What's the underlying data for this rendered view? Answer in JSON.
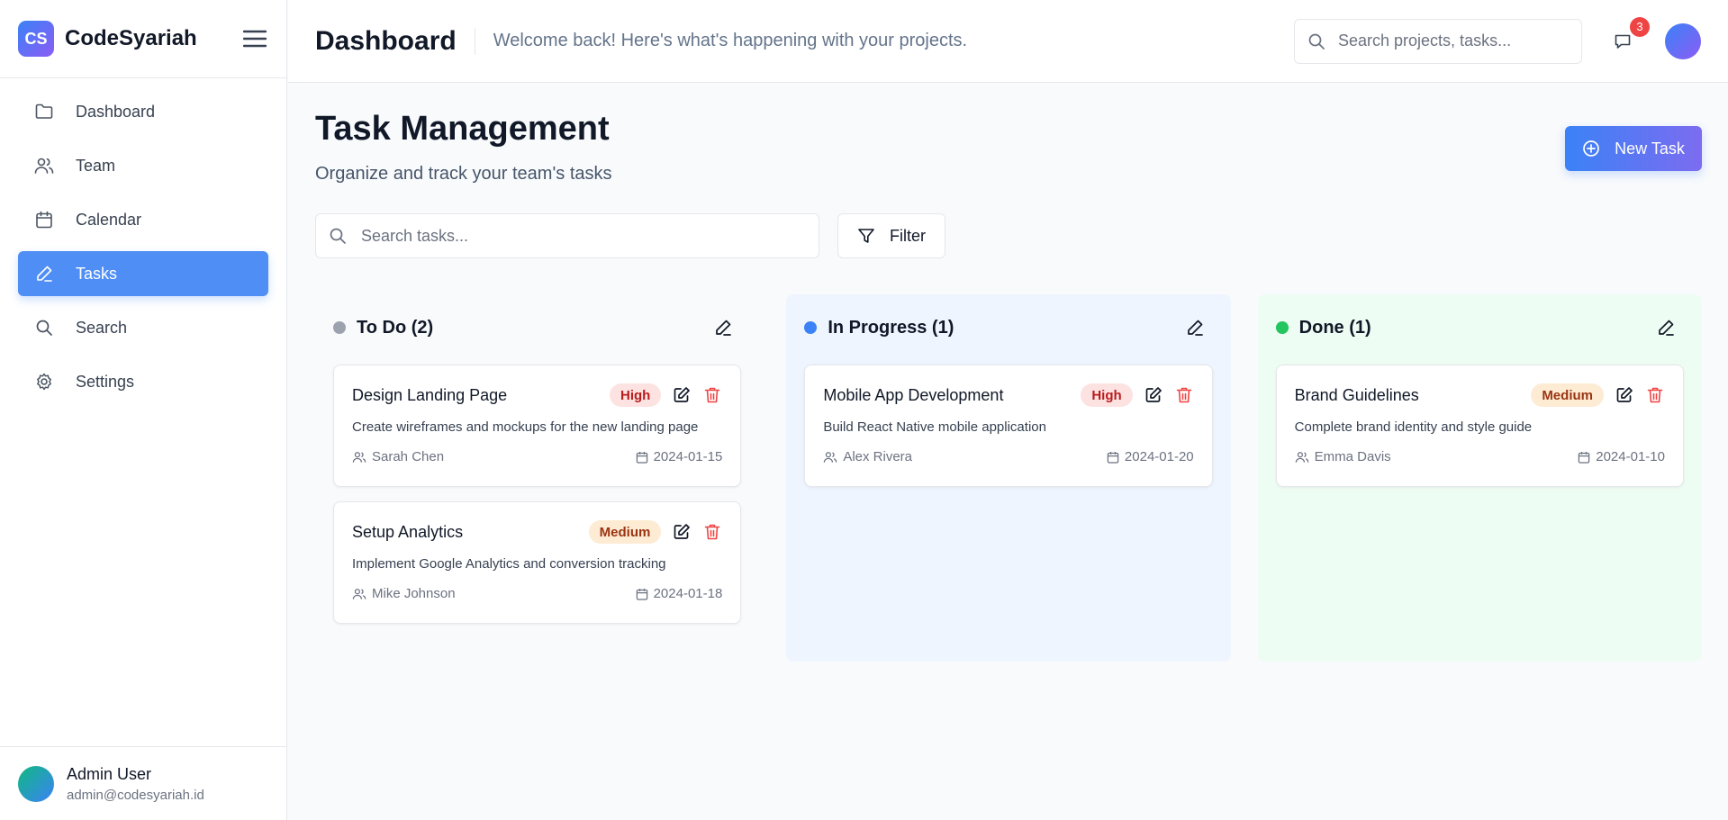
{
  "brand": {
    "logo_text": "CS",
    "name": "CodeSyariah"
  },
  "sidebar": {
    "items": [
      {
        "label": "Dashboard",
        "icon": "folder-icon"
      },
      {
        "label": "Team",
        "icon": "users-icon"
      },
      {
        "label": "Calendar",
        "icon": "calendar-icon"
      },
      {
        "label": "Tasks",
        "icon": "pencil-icon",
        "active": true
      },
      {
        "label": "Search",
        "icon": "search-icon"
      },
      {
        "label": "Settings",
        "icon": "gear-icon"
      }
    ],
    "user": {
      "name": "Admin User",
      "email": "admin@codesyariah.id"
    }
  },
  "header": {
    "title": "Dashboard",
    "subtitle": "Welcome back! Here's what's happening with your projects.",
    "search_placeholder": "Search projects, tasks...",
    "notification_count": "3"
  },
  "main": {
    "title": "Task Management",
    "subtitle": "Organize and track your team's tasks",
    "new_task_label": "New Task",
    "search_placeholder": "Search tasks...",
    "filter_label": "Filter",
    "columns": [
      {
        "title": "To Do (2)",
        "color": "#9ca3af",
        "tasks": [
          {
            "title": "Design Landing Page",
            "priority": "High",
            "description": "Create wireframes and mockups for the new landing page",
            "assignee": "Sarah Chen",
            "date": "2024-01-15"
          },
          {
            "title": "Setup Analytics",
            "priority": "Medium",
            "description": "Implement Google Analytics and conversion tracking",
            "assignee": "Mike Johnson",
            "date": "2024-01-18"
          }
        ]
      },
      {
        "title": "In Progress (1)",
        "color": "#3b82f6",
        "tasks": [
          {
            "title": "Mobile App Development",
            "priority": "High",
            "description": "Build React Native mobile application",
            "assignee": "Alex Rivera",
            "date": "2024-01-20"
          }
        ]
      },
      {
        "title": "Done (1)",
        "color": "#22c55e",
        "tasks": [
          {
            "title": "Brand Guidelines",
            "priority": "Medium",
            "description": "Complete brand identity and style guide",
            "assignee": "Emma Davis",
            "date": "2024-01-10"
          }
        ]
      }
    ]
  },
  "colors": {
    "primary": "#3b82f6",
    "accent": "#8b5cf6",
    "danger": "#ef4444"
  }
}
